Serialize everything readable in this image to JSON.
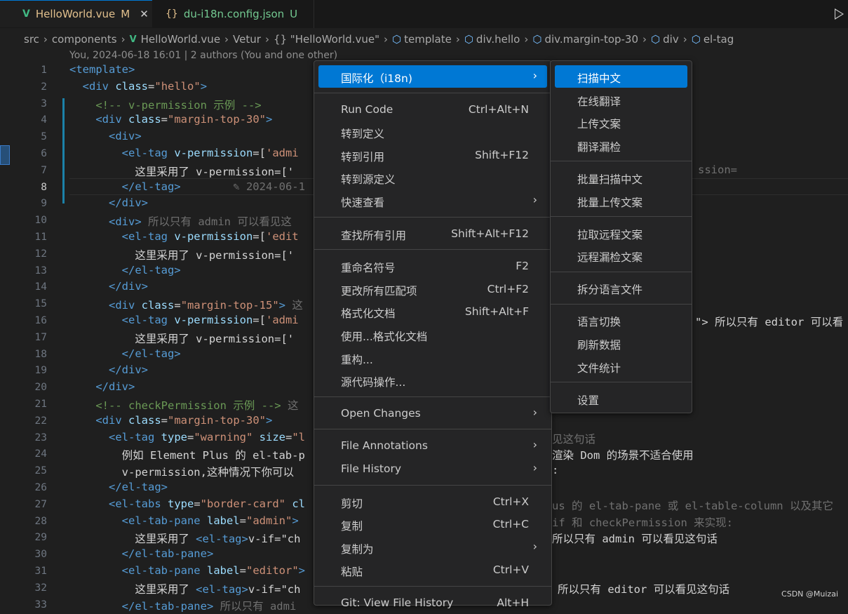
{
  "tabs": [
    {
      "label": "HelloWorld.vue",
      "status": "M",
      "icon": "vue-icon",
      "active": true
    },
    {
      "label": "du-i18n.config.json",
      "status": "U",
      "icon": "json-braces-icon",
      "active": false
    }
  ],
  "breadcrumb": [
    "src",
    "components",
    "HelloWorld.vue",
    "Vetur",
    "{} \"HelloWorld.vue\"",
    "template",
    "div.hello",
    "div.margin-top-30",
    "div",
    "el-tag"
  ],
  "blame": "You, 2024-06-18 16:01 | 2 authors (You and one other)",
  "lines": [
    {
      "n": "1",
      "segs": [
        [
          "t",
          "<template>"
        ]
      ]
    },
    {
      "n": "2",
      "segs": [
        [
          "p",
          "  "
        ],
        [
          "t",
          "<div "
        ],
        [
          "a",
          "class"
        ],
        [
          "p",
          "="
        ],
        [
          "s",
          "\"hello\""
        ],
        [
          "t",
          ">"
        ]
      ]
    },
    {
      "n": "3",
      "segs": [
        [
          "p",
          "    "
        ],
        [
          "c",
          "<!-- v-permission 示例 -->"
        ]
      ]
    },
    {
      "n": "4",
      "segs": [
        [
          "p",
          "    "
        ],
        [
          "t",
          "<div "
        ],
        [
          "a",
          "class"
        ],
        [
          "p",
          "="
        ],
        [
          "s",
          "\"margin-top-30\""
        ],
        [
          "t",
          ">"
        ]
      ]
    },
    {
      "n": "5",
      "segs": [
        [
          "p",
          "      "
        ],
        [
          "t",
          "<div>"
        ]
      ]
    },
    {
      "n": "6",
      "segs": [
        [
          "p",
          "        "
        ],
        [
          "t",
          "<el-tag "
        ],
        [
          "a",
          "v-permission"
        ],
        [
          "p",
          "="
        ],
        [
          "p",
          "["
        ],
        [
          "s",
          "'admi"
        ]
      ]
    },
    {
      "n": "7",
      "segs": [
        [
          "p",
          "          这里采用了 v-permission=['"
        ]
      ]
    },
    {
      "n": "8",
      "segs": [
        [
          "p",
          "        "
        ],
        [
          "t",
          "</el-tag>"
        ],
        [
          "d",
          "        ✎ 2024-06-1"
        ]
      ]
    },
    {
      "n": "9",
      "segs": [
        [
          "p",
          "      "
        ],
        [
          "t",
          "</div>"
        ]
      ]
    },
    {
      "n": "10",
      "segs": [
        [
          "p",
          "      "
        ],
        [
          "t",
          "<div>"
        ],
        [
          "d",
          " 所以只有 admin 可以看见这"
        ]
      ]
    },
    {
      "n": "11",
      "segs": [
        [
          "p",
          "        "
        ],
        [
          "t",
          "<el-tag "
        ],
        [
          "a",
          "v-permission"
        ],
        [
          "p",
          "="
        ],
        [
          "p",
          "["
        ],
        [
          "s",
          "'edit"
        ]
      ]
    },
    {
      "n": "12",
      "segs": [
        [
          "p",
          "          这里采用了 v-permission=['"
        ]
      ]
    },
    {
      "n": "13",
      "segs": [
        [
          "p",
          "        "
        ],
        [
          "t",
          "</el-tag>"
        ]
      ]
    },
    {
      "n": "14",
      "segs": [
        [
          "p",
          "      "
        ],
        [
          "t",
          "</div>"
        ]
      ]
    },
    {
      "n": "15",
      "segs": [
        [
          "p",
          "      "
        ],
        [
          "t",
          "<div "
        ],
        [
          "a",
          "class"
        ],
        [
          "p",
          "="
        ],
        [
          "s",
          "\"margin-top-15\""
        ],
        [
          "t",
          ">"
        ],
        [
          "d",
          " 这"
        ]
      ]
    },
    {
      "n": "16",
      "segs": [
        [
          "p",
          "        "
        ],
        [
          "t",
          "<el-tag "
        ],
        [
          "a",
          "v-permission"
        ],
        [
          "p",
          "="
        ],
        [
          "p",
          "["
        ],
        [
          "s",
          "'admi"
        ]
      ]
    },
    {
      "n": "17",
      "segs": [
        [
          "p",
          "          这里采用了 v-permission=['"
        ]
      ]
    },
    {
      "n": "18",
      "segs": [
        [
          "p",
          "        "
        ],
        [
          "t",
          "</el-tag>"
        ]
      ]
    },
    {
      "n": "19",
      "segs": [
        [
          "p",
          "      "
        ],
        [
          "t",
          "</div>"
        ]
      ]
    },
    {
      "n": "20",
      "segs": [
        [
          "p",
          "    "
        ],
        [
          "t",
          "</div>"
        ]
      ]
    },
    {
      "n": "21",
      "segs": [
        [
          "p",
          "    "
        ],
        [
          "c",
          "<!-- checkPermission 示例 -->"
        ],
        [
          "d",
          " 这"
        ]
      ]
    },
    {
      "n": "22",
      "segs": [
        [
          "p",
          "    "
        ],
        [
          "t",
          "<div "
        ],
        [
          "a",
          "class"
        ],
        [
          "p",
          "="
        ],
        [
          "s",
          "\"margin-top-30\""
        ],
        [
          "t",
          ">"
        ]
      ]
    },
    {
      "n": "23",
      "segs": [
        [
          "p",
          "      "
        ],
        [
          "t",
          "<el-tag "
        ],
        [
          "a",
          "type"
        ],
        [
          "p",
          "="
        ],
        [
          "s",
          "\"warning\""
        ],
        [
          "p",
          " "
        ],
        [
          "a",
          "size"
        ],
        [
          "p",
          "="
        ],
        [
          "s",
          "\"l"
        ]
      ]
    },
    {
      "n": "24",
      "segs": [
        [
          "p",
          "        例如 Element Plus 的 el-tab-p"
        ]
      ]
    },
    {
      "n": "25",
      "segs": [
        [
          "p",
          "        v-permission,这种情况下你可以"
        ]
      ]
    },
    {
      "n": "26",
      "segs": [
        [
          "p",
          "      "
        ],
        [
          "t",
          "</el-tag>"
        ]
      ]
    },
    {
      "n": "27",
      "segs": [
        [
          "p",
          "      "
        ],
        [
          "t",
          "<el-tabs "
        ],
        [
          "a",
          "type"
        ],
        [
          "p",
          "="
        ],
        [
          "s",
          "\"border-card\""
        ],
        [
          "p",
          " "
        ],
        [
          "a",
          "cl"
        ]
      ]
    },
    {
      "n": "28",
      "segs": [
        [
          "p",
          "        "
        ],
        [
          "t",
          "<el-tab-pane "
        ],
        [
          "a",
          "label"
        ],
        [
          "p",
          "="
        ],
        [
          "s",
          "\"admin\""
        ],
        [
          "t",
          ">"
        ]
      ]
    },
    {
      "n": "29",
      "segs": [
        [
          "p",
          "          这里采用了 "
        ],
        [
          "t",
          "<el-tag>"
        ],
        [
          "p",
          "v-if=\"ch"
        ]
      ]
    },
    {
      "n": "30",
      "segs": [
        [
          "p",
          "        "
        ],
        [
          "t",
          "</el-tab-pane>"
        ]
      ]
    },
    {
      "n": "31",
      "segs": [
        [
          "p",
          "        "
        ],
        [
          "t",
          "<el-tab-pane "
        ],
        [
          "a",
          "label"
        ],
        [
          "p",
          "="
        ],
        [
          "s",
          "\"editor\""
        ],
        [
          "t",
          ">"
        ]
      ]
    },
    {
      "n": "32",
      "segs": [
        [
          "p",
          "          这里采用了 "
        ],
        [
          "t",
          "<el-tag>"
        ],
        [
          "p",
          "v-if=\"ch"
        ]
      ]
    },
    {
      "n": "33",
      "segs": [
        [
          "p",
          "        "
        ],
        [
          "t",
          "</el-tab-pane>"
        ],
        [
          "d",
          " 所以只有 admi"
        ]
      ]
    }
  ],
  "right_fragments": [
    {
      "line": 7,
      "text": "ssion=",
      "dim": true
    },
    {
      "line": 16,
      "text": "\"> 所以只有 editor 可以看",
      "dim": false
    },
    {
      "line": 23,
      "text": "见这句话",
      "dim": true
    },
    {
      "line": 24,
      "text": "渲染 Dom 的场景不适合使用",
      "dim": false
    },
    {
      "line": 25,
      "text": ":",
      "dim": false
    },
    {
      "line": 27,
      "text": "us 的 el-tab-pane 或 el-table-column 以及其它",
      "dim": true
    },
    {
      "line": 28,
      "text": "if 和 checkPermission 来实现:",
      "dim": true
    },
    {
      "line": 29,
      "text": "所以只有 admin 可以看见这句话",
      "dim": false
    },
    {
      "line": 32,
      "text": "所以只有 editor 可以看见这句话",
      "dim": false
    }
  ],
  "context_menu": {
    "groups": [
      [
        {
          "label": "国际化（i18n)",
          "submenu": true,
          "selected": true
        }
      ],
      [
        {
          "label": "Run Code",
          "shortcut": "Ctrl+Alt+N"
        },
        {
          "label": "转到定义"
        },
        {
          "label": "转到引用",
          "shortcut": "Shift+F12"
        },
        {
          "label": "转到源定义"
        },
        {
          "label": "快速查看",
          "submenu": true
        }
      ],
      [
        {
          "label": "查找所有引用",
          "shortcut": "Shift+Alt+F12"
        }
      ],
      [
        {
          "label": "重命名符号",
          "shortcut": "F2"
        },
        {
          "label": "更改所有匹配项",
          "shortcut": "Ctrl+F2"
        },
        {
          "label": "格式化文档",
          "shortcut": "Shift+Alt+F"
        },
        {
          "label": "使用...格式化文档"
        },
        {
          "label": "重构..."
        },
        {
          "label": "源代码操作..."
        }
      ],
      [
        {
          "label": "Open Changes",
          "submenu": true
        }
      ],
      [
        {
          "label": "File Annotations",
          "submenu": true
        },
        {
          "label": "File History",
          "submenu": true
        }
      ],
      [
        {
          "label": "剪切",
          "shortcut": "Ctrl+X"
        },
        {
          "label": "复制",
          "shortcut": "Ctrl+C"
        },
        {
          "label": "复制为",
          "submenu": true
        },
        {
          "label": "粘贴",
          "shortcut": "Ctrl+V"
        }
      ],
      [
        {
          "label": "Git: View File History",
          "shortcut": "Alt+H"
        }
      ]
    ]
  },
  "submenu": {
    "groups": [
      [
        {
          "label": "扫描中文",
          "selected": true
        },
        {
          "label": "在线翻译"
        },
        {
          "label": "上传文案"
        },
        {
          "label": "翻译漏检"
        }
      ],
      [
        {
          "label": "批量扫描中文"
        },
        {
          "label": "批量上传文案"
        }
      ],
      [
        {
          "label": "拉取远程文案"
        },
        {
          "label": "远程漏检文案"
        }
      ],
      [
        {
          "label": "拆分语言文件"
        }
      ],
      [
        {
          "label": "语言切换"
        },
        {
          "label": "刷新数据"
        },
        {
          "label": "文件统计"
        }
      ],
      [
        {
          "label": "设置"
        }
      ]
    ]
  },
  "watermark": "CSDN @Muizai",
  "colors": {
    "accent": "#0078d4",
    "vue": "#41b883",
    "tag": "#569cd6",
    "attr": "#9cdcfe",
    "string": "#ce9178",
    "comment": "#6a9955"
  }
}
